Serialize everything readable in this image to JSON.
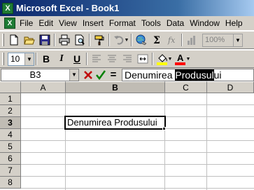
{
  "window": {
    "title": "Microsoft Excel - Book1",
    "app_icon_letter": "X"
  },
  "menu": [
    "File",
    "Edit",
    "View",
    "Insert",
    "Format",
    "Tools",
    "Data",
    "Window",
    "Help"
  ],
  "toolbar_standard": {
    "zoom": "100%"
  },
  "toolbar_formatting": {
    "font_size": "10",
    "bold_label": "B",
    "italic_label": "I",
    "underline_label": "U",
    "font_color_letter": "A",
    "fill_color": "#ffff00",
    "font_color": "#ff0000"
  },
  "formula_bar": {
    "name_box": "B3",
    "equals": "=",
    "formula_before": "Denumirea ",
    "formula_selected": "Produsul",
    "formula_after": "ui"
  },
  "sheet": {
    "columns": [
      "A",
      "B",
      "C",
      "D"
    ],
    "rows": [
      "1",
      "2",
      "3",
      "4",
      "5",
      "6",
      "7",
      "8"
    ],
    "active_cell": "B3",
    "active_cell_value": "Denumirea Produsului"
  }
}
